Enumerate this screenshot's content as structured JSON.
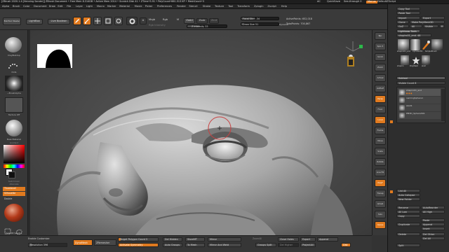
{
  "titlebar": {
    "text": "[ZBrush 2020.1.4 [Henning Sander]] ZBrush Document   • Free Mem 8.314GB • Active Mem 2014 • Scratch Disk 41 • ZTime•5.91 • PolyCount•661.513 KP • MeshCount•3",
    "ac": "AC",
    "quicksave": "QuickSave",
    "seethrough": "See-through  0",
    "menus": "Menus",
    "script": "DefaultZScript"
  },
  "menubar": [
    "Alpha",
    "Brush",
    "Color",
    "Document",
    "Draw",
    "Edit",
    "File",
    "Layer",
    "Light",
    "Macro",
    "Marker",
    "Material",
    "Movie",
    "Picker",
    "Preferences",
    "Render",
    "Stencil",
    "Stroke",
    "Texture",
    "Tool",
    "Transform",
    "Zplugin",
    "Zscript",
    "Help"
  ],
  "coords": "0.359,-0.062,-0.768",
  "toolbar": {
    "home_page": "BokTool Master",
    "lightbox": "LightBox",
    "live_boolean": "Live Boolean",
    "edit": "Edit",
    "draw": "Draw",
    "move": "Move",
    "scale": "Scale",
    "rotate": "Rotate",
    "a_label": "A",
    "mrgb": "Mrgb",
    "rgb": "Rgb",
    "m": "M",
    "zadd": "Zadd",
    "zsub": "Zsub",
    "zcut": "Zcut",
    "rgb_intensity": "Rgb Intensity",
    "z_intensity": "Z Intensity 33",
    "z_intensity_value": 33,
    "focal_shift": "Focal Shift -34",
    "focal_shift_value": -34,
    "draw_size": "Draw Size 51",
    "draw_size_value": 51,
    "dynamic": "Dynamic",
    "active_points": "ActivePoints: 652,018",
    "total_points": "TotalPoints: 700,867"
  },
  "left_shelf": {
    "brush_label": "ClayBuildup",
    "stroke_label": "Dots",
    "alpha_label": "~BrushAlpha",
    "texture_label": "Texture Off",
    "material_label": "BasicMaterial",
    "gradient": "Gradient",
    "switch_color": "SwitchColor",
    "alternate": "Alternate",
    "thumbnail": "Thumbnail",
    "silhouette": "Silhouette",
    "double": "Double",
    "selection_label": "SelectRt  SelectLs"
  },
  "right_shelf": [
    "Bpr",
    "Spix 3",
    "Scroll",
    "Zoom",
    "Actual",
    "AAHalf",
    "Persp",
    "Floor",
    "Local",
    "Frame",
    "Move",
    "Scale",
    "Rotate",
    "Line Fill",
    "PolyF",
    "Transp",
    "Ghost",
    "Solo",
    "Xpose"
  ],
  "right_panel": {
    "copy_tool": "Copy Tool",
    "paste_tool": "Paste Tool",
    "import": "Import",
    "export": "Export",
    "clone": "Clone",
    "make_polymesh": "Make PolyMesh3D",
    "goz": "GoZ",
    "all": "All",
    "visible": "Visible",
    "r": "R",
    "lightbox_tools": "Lightbox▸ Tools",
    "current_tool": "shapiro01_end. 48",
    "tool_names": [
      "shapiro01_end",
      "Cylinder3D",
      "SimpleBrush",
      "shapiro",
      "PolyMesh",
      "skull"
    ],
    "subtool": "Subtool",
    "visible_count": "Visible Count 6",
    "subtools": [
      "shapiro01_end",
      "ownlingSphere1",
      "skull1",
      "PM3D_Sphere3D1"
    ],
    "list_all": "List All",
    "auto_collapse": "Auto Collapse",
    "new_folder": "New Folder",
    "rename": "Rename",
    "auto_reorder": "AutoReorder",
    "all_low": "All Low",
    "all_high": "All High",
    "copy": "Copy",
    "paste": "Paste",
    "duplicate": "Duplicate",
    "append": "Append",
    "insert": "Insert",
    "delete": "Delete",
    "del_other": "Del Other",
    "del_all": "Del All",
    "split": "Split"
  },
  "bottombar": {
    "enable_customize": "Enable Customize",
    "resolution": "Resolution 396",
    "resolution_value": 396,
    "dynamesh": "DynaMesh",
    "zremesher": "ZRemesher",
    "target_polycount": "Target Polygon Count 5",
    "activate_symmetry": "Activate Symmetry",
    "del_hidden": "Del Hidden",
    "auto_groups": "Auto Groups",
    "store_mt": "StoreMT",
    "to_mesh": "To Mesh",
    "mirror": "Mirror",
    "mirror_and_weld": "Mirror And Weld",
    "zoomall": "ZoomAll",
    "groups_split": "Groups Split",
    "close_holes": "Close Holes",
    "del_lower": "Del Lower",
    "del_higher": "Del Higher",
    "export": "Export",
    "projectall": "ProjectAll",
    "append": "Append",
    "dist": "Dist"
  },
  "colors": {
    "accent": "#e07a1f",
    "panel": "#383838",
    "canvas": "#4a4a4a"
  }
}
